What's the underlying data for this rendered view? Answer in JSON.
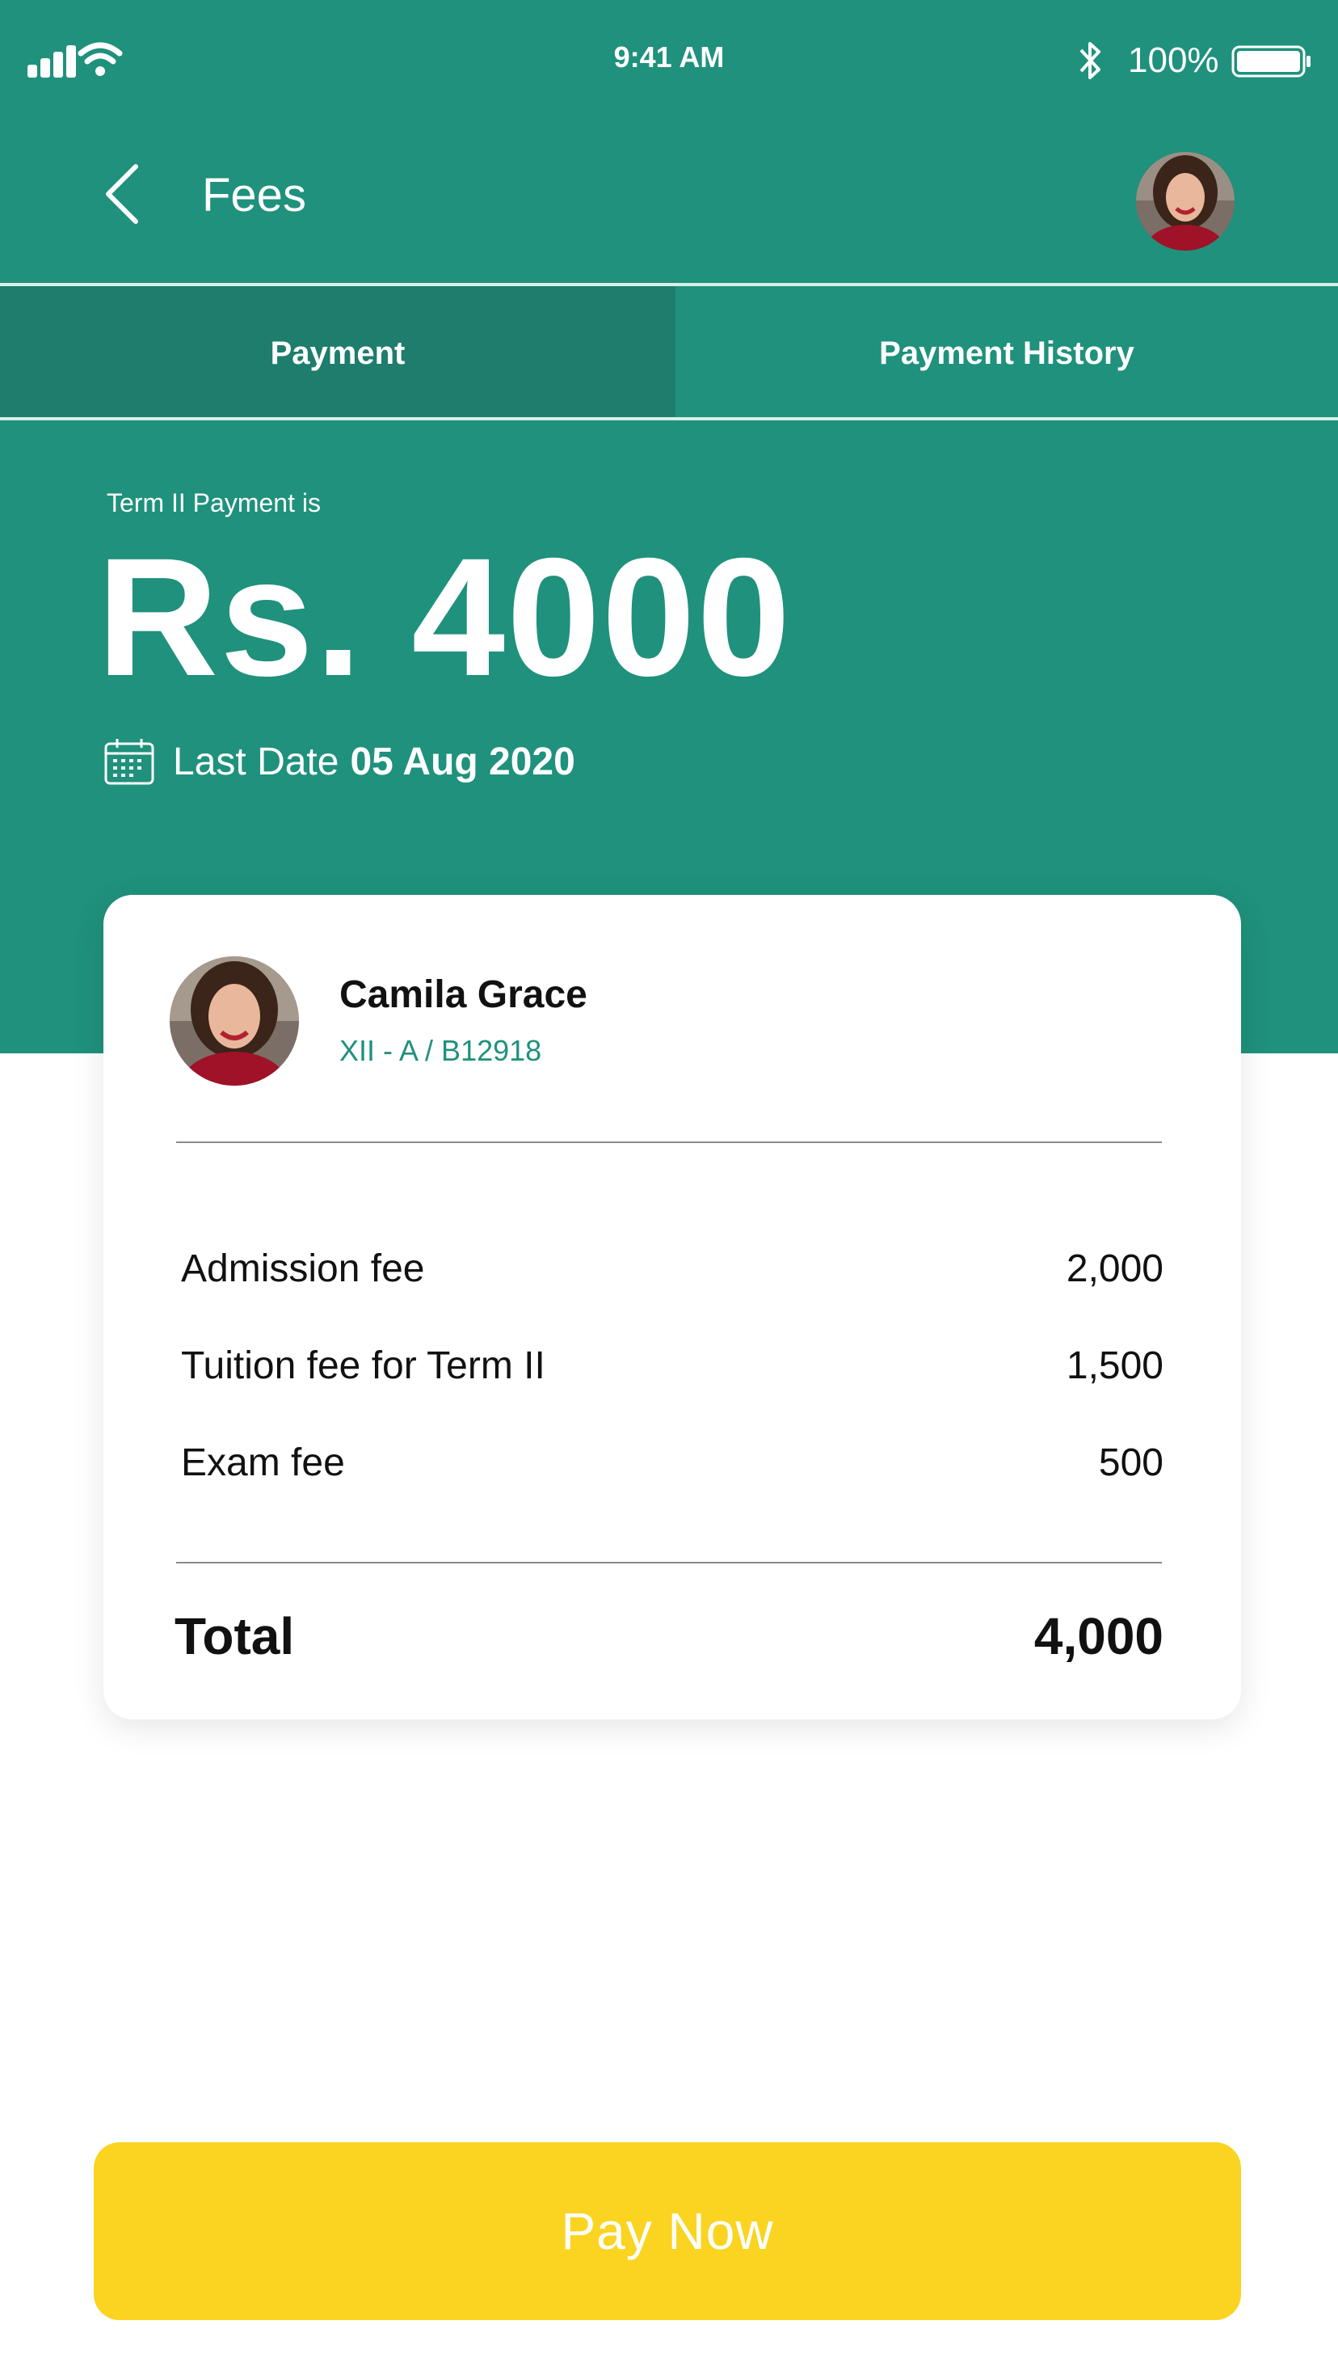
{
  "status_bar": {
    "time": "9:41 AM",
    "battery": "100%"
  },
  "header": {
    "title": "Fees"
  },
  "tabs": [
    {
      "label": "Payment",
      "active": true
    },
    {
      "label": "Payment History",
      "active": false
    }
  ],
  "summary": {
    "term_label": "Term II Payment is",
    "amount": "Rs. 4000",
    "last_date_label": "Last Date",
    "last_date_value": "05 Aug 2020"
  },
  "student": {
    "name": "Camila Grace",
    "class_id": "XII - A / B12918"
  },
  "fees": [
    {
      "label": "Admission fee",
      "amount": "2,000"
    },
    {
      "label": "Tuition fee for Term II",
      "amount": "1,500"
    },
    {
      "label": "Exam fee",
      "amount": "500"
    }
  ],
  "total": {
    "label": "Total",
    "amount": "4,000"
  },
  "pay_button": {
    "label": "Pay Now"
  },
  "colors": {
    "primary": "#1f917c",
    "tab_active": "#1e7d6c",
    "accent": "#fad420"
  },
  "icons": {
    "back": "chevron-left-icon",
    "calendar": "calendar-icon",
    "signal": "cellular-signal-icon",
    "wifi": "wifi-icon",
    "bluetooth": "bluetooth-icon",
    "battery": "battery-icon"
  }
}
